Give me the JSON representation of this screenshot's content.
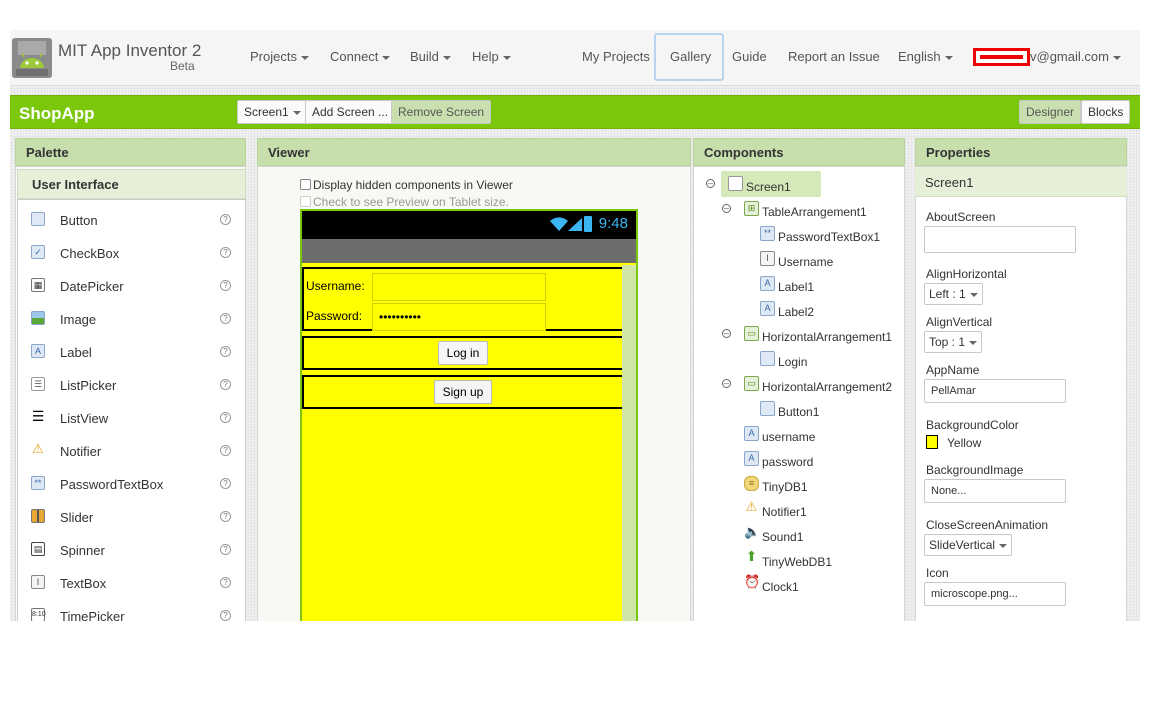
{
  "header": {
    "brand_title": "MIT App Inventor 2",
    "brand_subtitle": "Beta",
    "menus": [
      "Projects",
      "Connect",
      "Build",
      "Help"
    ],
    "links": [
      "My Projects",
      "Gallery",
      "Guide",
      "Report an Issue"
    ],
    "language": "English",
    "account": "v@gmail.com"
  },
  "project_bar": {
    "project_name": "ShopApp",
    "screen_select": "Screen1",
    "add_screen": "Add Screen ...",
    "remove_screen": "Remove Screen",
    "designer": "Designer",
    "blocks": "Blocks"
  },
  "palette": {
    "title": "Palette",
    "section": "User Interface",
    "items": [
      {
        "label": "Button",
        "icon": "button-icon"
      },
      {
        "label": "CheckBox",
        "icon": "checkbox-icon"
      },
      {
        "label": "DatePicker",
        "icon": "calendar-icon"
      },
      {
        "label": "Image",
        "icon": "image-icon"
      },
      {
        "label": "Label",
        "icon": "label-icon"
      },
      {
        "label": "ListPicker",
        "icon": "list-icon"
      },
      {
        "label": "ListView",
        "icon": "listview-icon"
      },
      {
        "label": "Notifier",
        "icon": "warning-icon"
      },
      {
        "label": "PasswordTextBox",
        "icon": "password-icon"
      },
      {
        "label": "Slider",
        "icon": "slider-icon"
      },
      {
        "label": "Spinner",
        "icon": "spinner-icon"
      },
      {
        "label": "TextBox",
        "icon": "textbox-icon"
      },
      {
        "label": "TimePicker",
        "icon": "clock-icon"
      }
    ],
    "help_glyph": "?"
  },
  "viewer": {
    "title": "Viewer",
    "hidden_components": "Display hidden components in Viewer",
    "tablet_preview": "Check to see Preview on Tablet size.",
    "clock": "9:48",
    "username_label": "Username:",
    "password_label": "Password:",
    "password_value": "••••••••••",
    "login_button": "Log in",
    "signup_button": "Sign up",
    "background_color": "#ffff00"
  },
  "components": {
    "title": "Components",
    "tree": [
      {
        "label": "Screen1",
        "icon": "screen-icon",
        "expanded": true,
        "selected": true
      },
      {
        "label": "TableArrangement1",
        "icon": "table-icon",
        "expanded": true
      },
      {
        "label": "PasswordTextBox1",
        "icon": "password-icon"
      },
      {
        "label": "Username",
        "icon": "textbox-icon"
      },
      {
        "label": "Label1",
        "icon": "label-icon"
      },
      {
        "label": "Label2",
        "icon": "label-icon"
      },
      {
        "label": "HorizontalArrangement1",
        "icon": "horizontal-arrangement-icon",
        "expanded": true
      },
      {
        "label": "Login",
        "icon": "button-icon"
      },
      {
        "label": "HorizontalArrangement2",
        "icon": "horizontal-arrangement-icon",
        "expanded": true
      },
      {
        "label": "Button1",
        "icon": "button-icon"
      },
      {
        "label": "username",
        "icon": "label-icon"
      },
      {
        "label": "password",
        "icon": "label-icon"
      },
      {
        "label": "TinyDB1",
        "icon": "database-icon"
      },
      {
        "label": "Notifier1",
        "icon": "warning-icon"
      },
      {
        "label": "Sound1",
        "icon": "sound-icon"
      },
      {
        "label": "TinyWebDB1",
        "icon": "upload-icon"
      },
      {
        "label": "Clock1",
        "icon": "alarm-clock-icon"
      }
    ]
  },
  "properties": {
    "title": "Properties",
    "component": "Screen1",
    "about_screen_label": "AboutScreen",
    "about_screen_value": "",
    "align_horizontal_label": "AlignHorizontal",
    "align_horizontal_value": "Left : 1",
    "align_vertical_label": "AlignVertical",
    "align_vertical_value": "Top : 1",
    "app_name_label": "AppName",
    "app_name_value": "PellAmar",
    "background_color_label": "BackgroundColor",
    "background_color_value": "Yellow",
    "background_color_swatch": "#ffff00",
    "background_image_label": "BackgroundImage",
    "background_image_value": "None...",
    "close_anim_label": "CloseScreenAnimation",
    "close_anim_value": "SlideVertical",
    "icon_label": "Icon",
    "icon_value": "microscope.png..."
  },
  "colors": {
    "accent_green": "#7ac70c",
    "panel_header": "#c6dfad",
    "clock_blue": "#3cb6f3"
  }
}
